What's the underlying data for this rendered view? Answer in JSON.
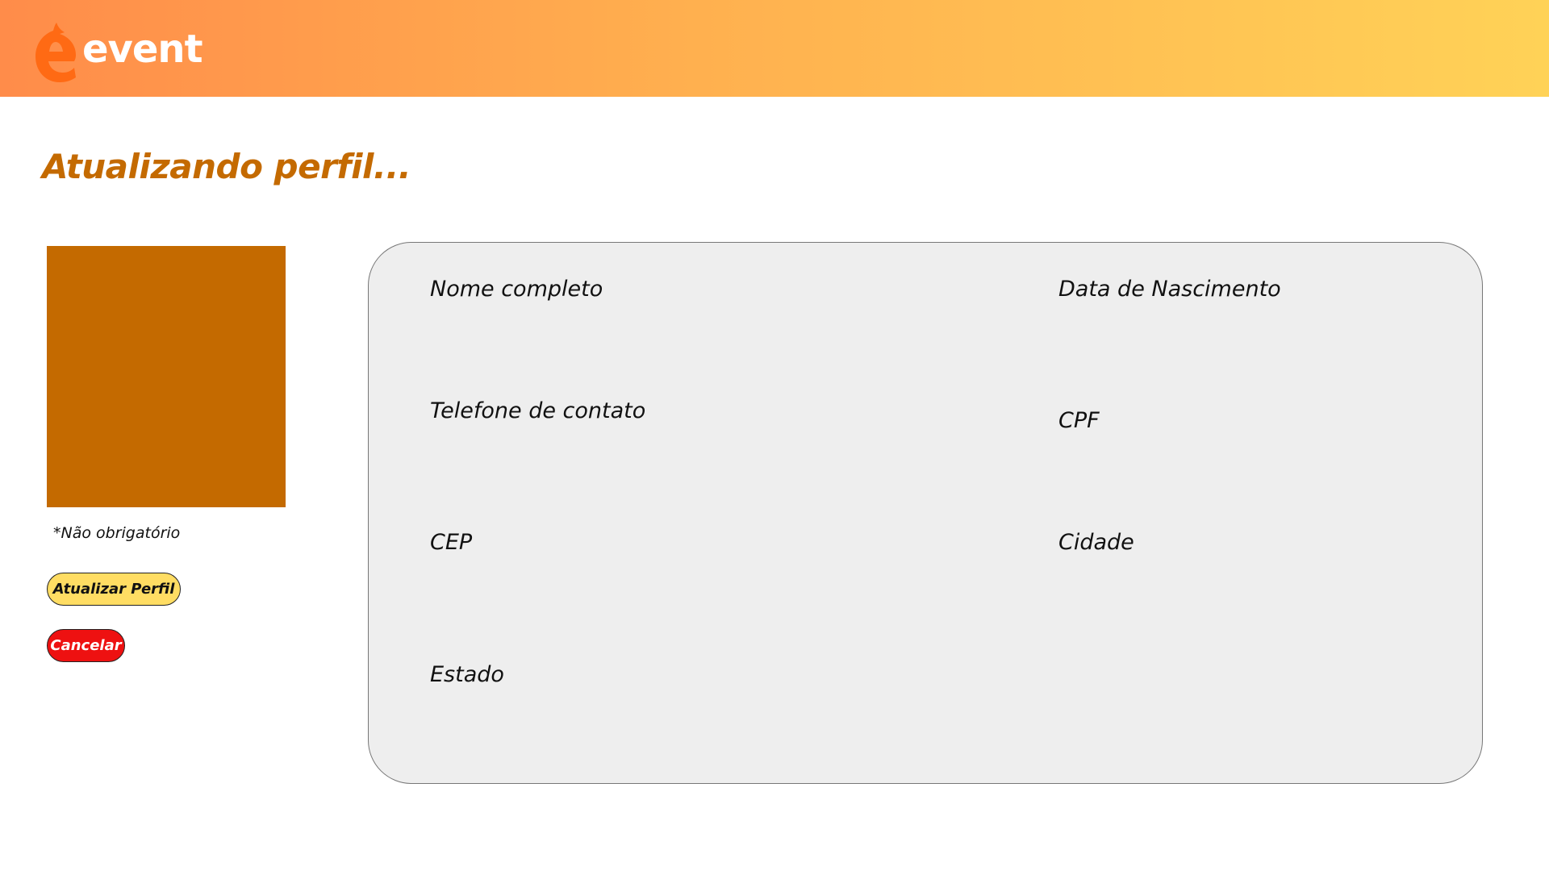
{
  "header": {
    "brand_name": "event",
    "logo_icon": "event-e-logo-icon",
    "gradient_colors": [
      "#ff8c4a",
      "#ffd257"
    ]
  },
  "page": {
    "title": "Atualizando perfil..."
  },
  "profile": {
    "photo_color": "#c46a00",
    "optional_note": "*Não obrigatório"
  },
  "actions": {
    "update_label": "Atualizar Perfil",
    "update_color": "#ffdd63",
    "cancel_label": "Cancelar",
    "cancel_color": "#ee1111"
  },
  "form": {
    "fields": [
      {
        "label": "Nome completo"
      },
      {
        "label": "Data de Nascimento"
      },
      {
        "label": "Telefone de contato"
      },
      {
        "label": "CPF"
      },
      {
        "label": "CEP"
      },
      {
        "label": "Cidade"
      },
      {
        "label": "Estado"
      }
    ]
  },
  "colors": {
    "accent": "#c46a00",
    "panel_background": "#eeeeee"
  }
}
